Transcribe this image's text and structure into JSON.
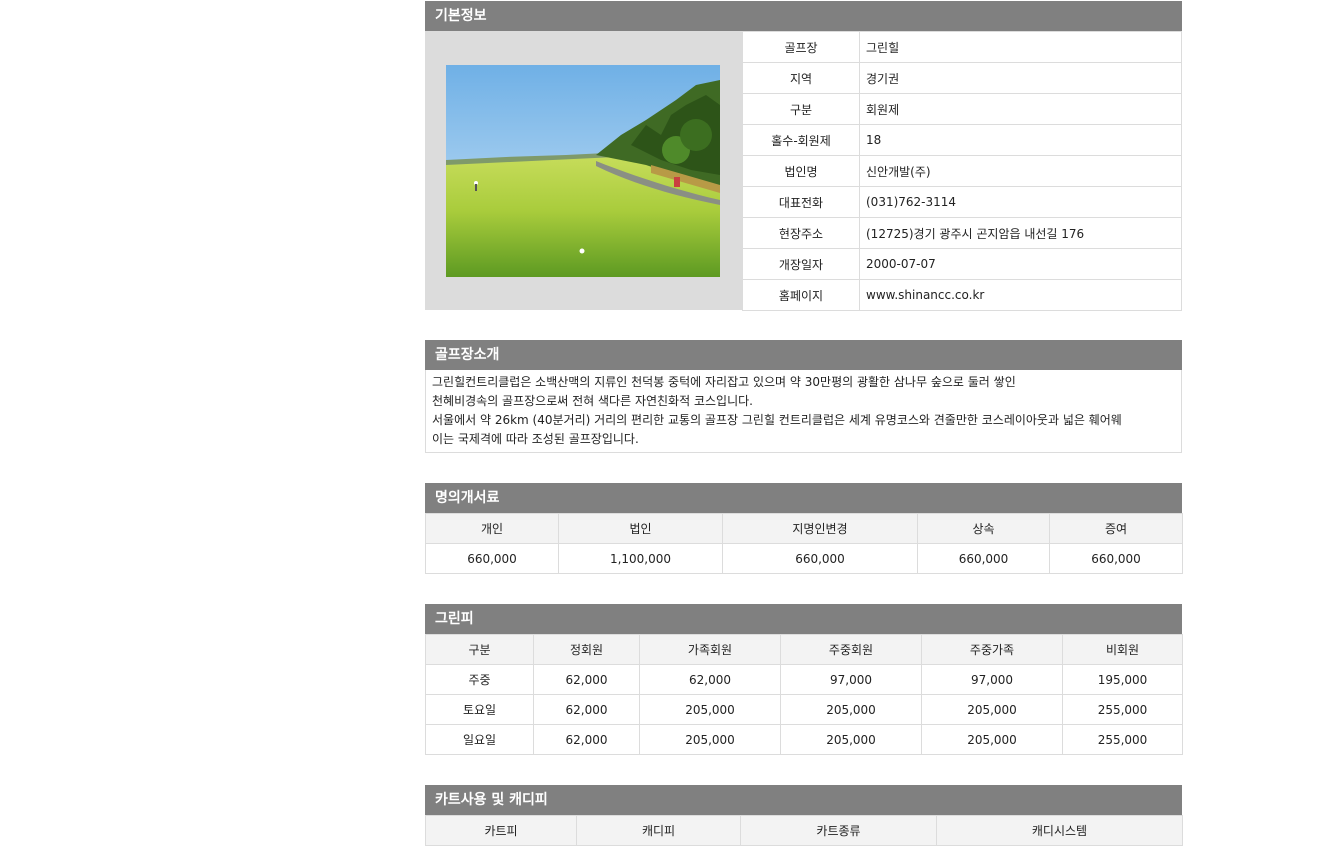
{
  "basic": {
    "title": "기본정보",
    "rows": [
      {
        "label": "골프장",
        "value": "그린힐"
      },
      {
        "label": "지역",
        "value": "경기권"
      },
      {
        "label": "구분",
        "value": "회원제"
      },
      {
        "label": "홀수-회원제",
        "value": "18"
      },
      {
        "label": "법인명",
        "value": "신안개발(주)"
      },
      {
        "label": "대표전화",
        "value": "(031)762-3114"
      },
      {
        "label": "현장주소",
        "value": "(12725)경기 광주시 곤지암읍 내선길 176"
      },
      {
        "label": "개장일자",
        "value": "2000-07-07"
      },
      {
        "label": "홈페이지",
        "value": "www.shinancc.co.kr"
      }
    ]
  },
  "intro": {
    "title": "골프장소개",
    "lines": [
      "그린힐컨트리클럽은 소백산맥의 지류인 천덕봉 중턱에 자리잡고 있으며 약 30만평의 광활한 삼나무 숲으로 둘러 쌓인",
      "천혜비경속의 골프장으로써 전혀 색다른 자연친화적 코스입니다.",
      "서울에서 약 26km (40분거리) 거리의 편리한 교통의 골프장 그린힐 컨트리클럽은 세계 유명코스와 견줄만한 코스레이아웃과 넓은 훼어웨",
      "이는 국제격에 따라 조성된 골프장입니다."
    ]
  },
  "transfer": {
    "title": "명의개서료",
    "headers": [
      "개인",
      "법인",
      "지명인변경",
      "상속",
      "증여"
    ],
    "values": [
      "660,000",
      "1,100,000",
      "660,000",
      "660,000",
      "660,000"
    ]
  },
  "greenfee": {
    "title": "그린피",
    "headers": [
      "구분",
      "정회원",
      "가족회원",
      "주중회원",
      "주중가족",
      "비회원"
    ],
    "rows": [
      [
        "주중",
        "62,000",
        "62,000",
        "97,000",
        "97,000",
        "195,000"
      ],
      [
        "토요일",
        "62,000",
        "205,000",
        "205,000",
        "205,000",
        "255,000"
      ],
      [
        "일요일",
        "62,000",
        "205,000",
        "205,000",
        "205,000",
        "255,000"
      ]
    ]
  },
  "cart": {
    "title": "카트사용 및 캐디피",
    "headers": [
      "카트피",
      "캐디피",
      "카트종류",
      "캐디시스템"
    ]
  },
  "colors": {
    "header_bg": "#808080",
    "cell_bg": "#f3f3f3",
    "border": "#dcdcdc",
    "photo_frame": "#dcdcdc"
  }
}
